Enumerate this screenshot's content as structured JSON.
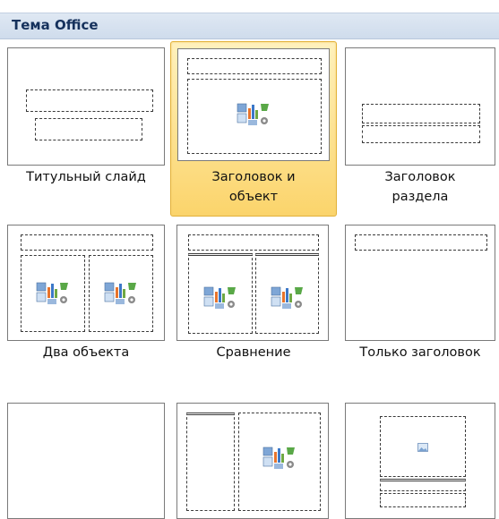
{
  "gallery": {
    "title": "Тема Office",
    "layouts": [
      {
        "label_lines": [
          "Титульный слайд"
        ]
      },
      {
        "label_lines": [
          "Заголовок и",
          "объект"
        ],
        "selected": true
      },
      {
        "label_lines": [
          "Заголовок",
          "раздела"
        ]
      },
      {
        "label_lines": [
          "Два объекта"
        ]
      },
      {
        "label_lines": [
          "Сравнение"
        ]
      },
      {
        "label_lines": [
          "Только заголовок"
        ]
      },
      {
        "label_lines": []
      },
      {
        "label_lines": []
      },
      {
        "label_lines": []
      }
    ]
  },
  "colors": {
    "selected_bg": "#fbd46b",
    "header_bg": "#dfe8f3",
    "header_text": "#15315c"
  },
  "icons": {
    "content": "insert-content-icon",
    "picture": "picture-icon"
  }
}
